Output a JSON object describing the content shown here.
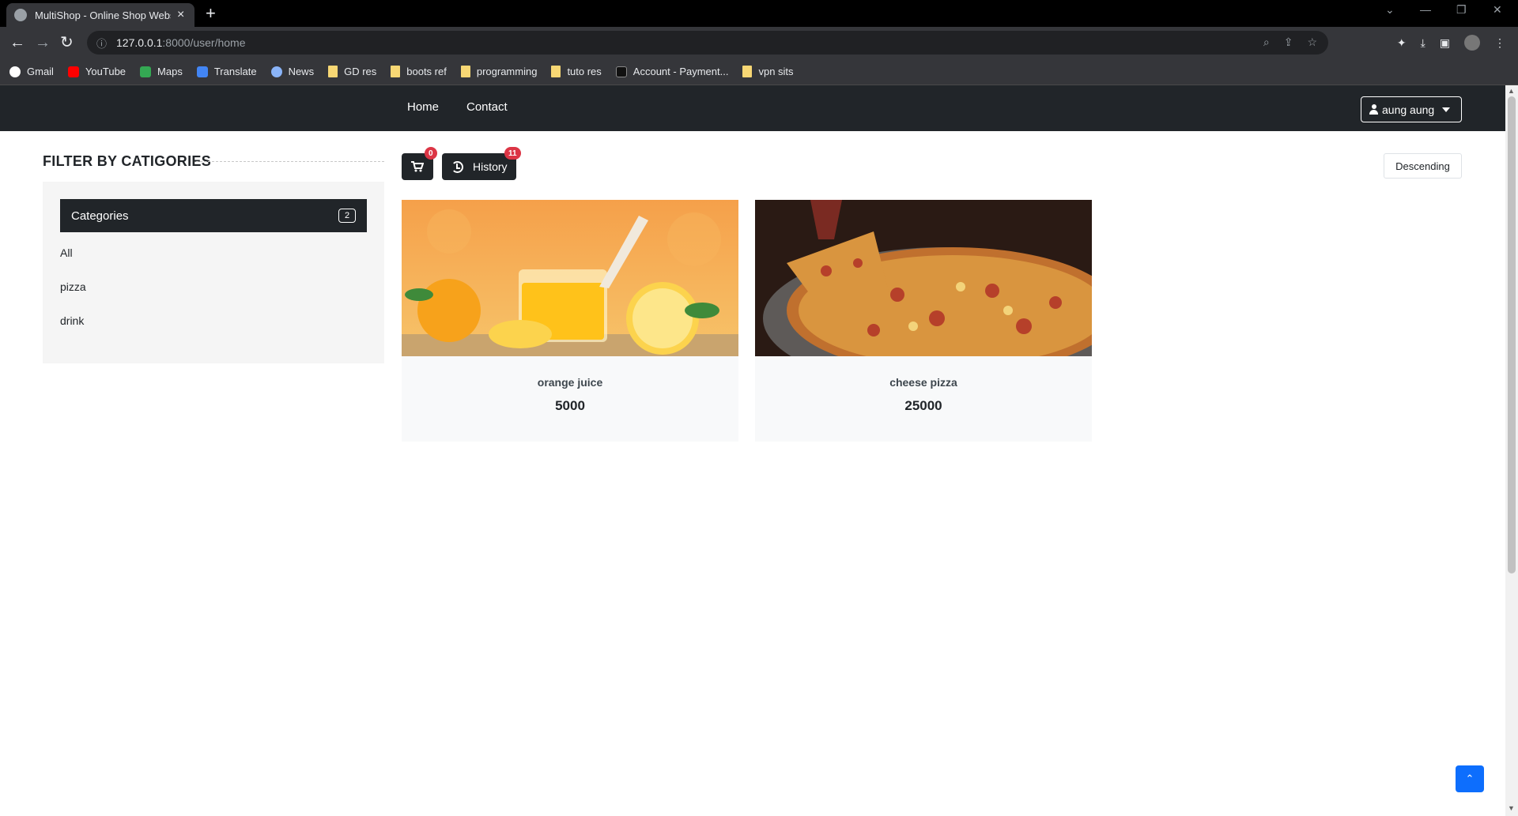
{
  "browser": {
    "tab_title": "MultiShop - Online Shop Website",
    "tab_close": "×",
    "new_tab": "+",
    "url_host": "127.0.0.1",
    "url_path": ":8000/user/home",
    "bookmarks": [
      "Gmail",
      "YouTube",
      "Maps",
      "Translate",
      "News",
      "GD res",
      "boots ref",
      "programming",
      "tuto res",
      "Account - Payment...",
      "vpn sits"
    ]
  },
  "nav": {
    "home": "Home",
    "contact": "Contact",
    "user": "aung aung"
  },
  "filter": {
    "title": "FILTER BY CATIGORIES",
    "header": "Categories",
    "count": "2",
    "items": [
      "All",
      "pizza",
      "drink"
    ]
  },
  "toolbar": {
    "cart_badge": "0",
    "history_label": "History",
    "history_badge": "11",
    "sort_label": "Descending"
  },
  "products": [
    {
      "name": "orange juice",
      "price": "5000"
    },
    {
      "name": "cheese pizza",
      "price": "25000"
    }
  ],
  "colors": {
    "nav_bg": "#212529",
    "badge": "#dc3545",
    "back_to_top": "#0d6efd"
  }
}
